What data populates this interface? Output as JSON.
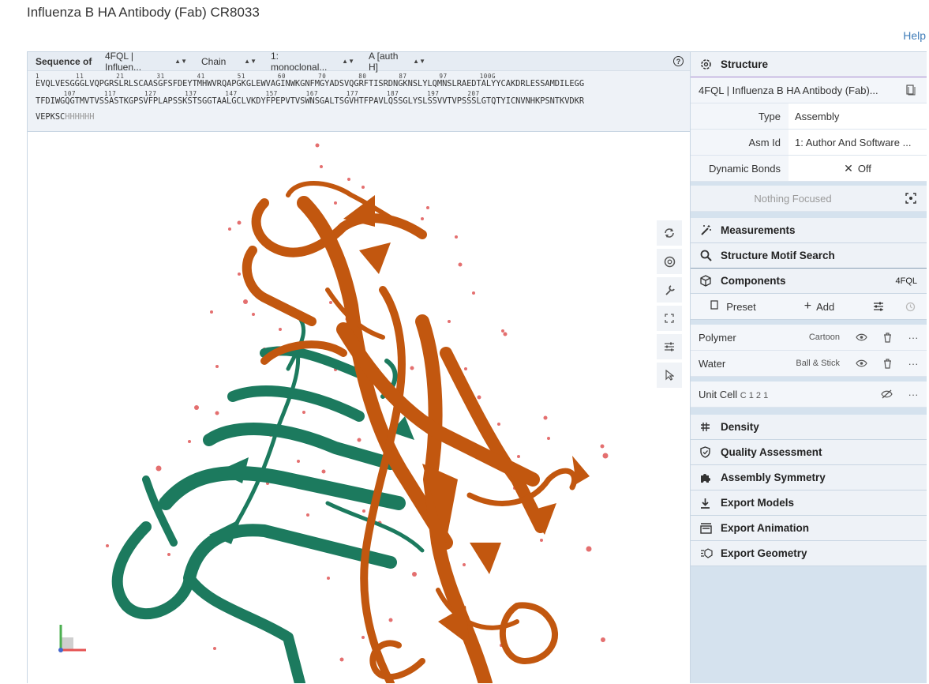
{
  "page": {
    "title": "Influenza B HA Antibody (Fab) CR8033",
    "help_label": "Help"
  },
  "sequence": {
    "label": "Sequence of",
    "entry_select": "4FQL | Influen...",
    "mode_select": "Chain",
    "entity_select": "1: monoclonal...",
    "chain_select": "A [auth H]",
    "nums_line1": "1         11        21        31        41        51        60        70        80        87        97        100G",
    "seq_line1": "EVQLVESGGGLVQPGRSLRLSCAASGFSFDEYTMHWVRQAPGKGLEWVAGINWKGNFMGYADSVQGRFTISRDNGKNSLYLQMNSLRAEDTALYYCAKDRLESSAMDILEGG",
    "nums_line2": "       107       117       127       137       147       157       167       177       187       197       207",
    "seq_line2": "TFDIWGQGTMVTVSSASTKGPSVFPLAPSSKSTSGGTAALGCLVKDYFPEPVTVSWNSGALTSGVHTFPAVLQSSGLYSLSSVVTVPSSSLGTQTYICNVNHKPSNTKVDKR",
    "seq_line3_main": "VEPKSC",
    "seq_line3_gray": "HHHHHH"
  },
  "controls": {
    "structure": {
      "header": "Structure",
      "entry": "4FQL | Influenza B HA Antibody (Fab)...",
      "type_label": "Type",
      "type_value": "Assembly",
      "asm_label": "Asm Id",
      "asm_value": "1: Author And Software ...",
      "dyn_label": "Dynamic Bonds",
      "dyn_value": "Off",
      "focus": "Nothing Focused"
    },
    "measurements": "Measurements",
    "motif": "Structure Motif Search",
    "components": {
      "header": "Components",
      "badge": "4FQL",
      "preset": "Preset",
      "add": "Add",
      "items": [
        {
          "name": "Polymer",
          "repr": "Cartoon"
        },
        {
          "name": "Water",
          "repr": "Ball & Stick"
        }
      ],
      "unit_cell": "Unit Cell",
      "unit_cell_sub": "C 1 2 1"
    },
    "sections": [
      "Density",
      "Quality Assessment",
      "Assembly Symmetry",
      "Export Models",
      "Export Animation",
      "Export Geometry"
    ]
  },
  "colors": {
    "chain_heavy": "#c2570f",
    "chain_light": "#1c7a5e",
    "water": "#e46f6f",
    "accent": "#3f7cb8"
  }
}
